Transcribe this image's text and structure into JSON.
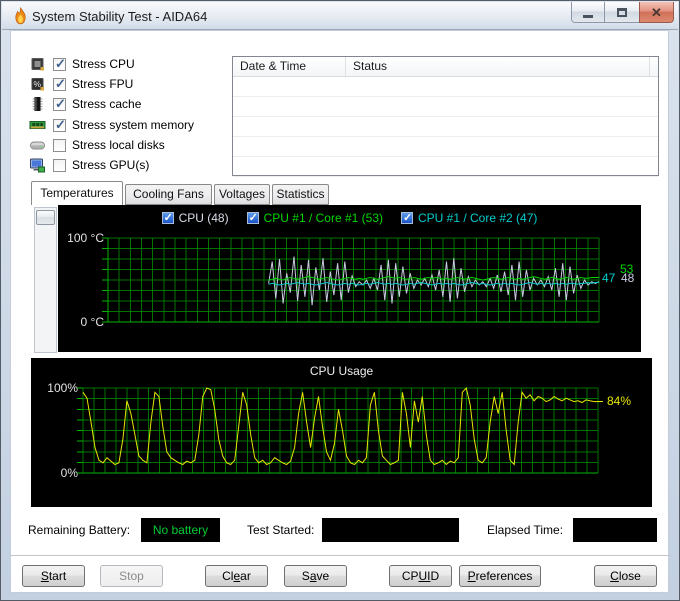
{
  "window": {
    "title": "System Stability Test - AIDA64",
    "icon": "flame-icon",
    "controls": [
      "minimize",
      "maximize",
      "close"
    ]
  },
  "stress": {
    "items": [
      {
        "id": "cpu",
        "label": "Stress CPU",
        "checked": true,
        "icon": "cpu-icon"
      },
      {
        "id": "fpu",
        "label": "Stress FPU",
        "checked": true,
        "icon": "fpu-icon"
      },
      {
        "id": "cache",
        "label": "Stress cache",
        "checked": true,
        "icon": "cache-icon"
      },
      {
        "id": "memory",
        "label": "Stress system memory",
        "checked": true,
        "icon": "memory-icon"
      },
      {
        "id": "disks",
        "label": "Stress local disks",
        "checked": false,
        "icon": "disk-icon"
      },
      {
        "id": "gpu",
        "label": "Stress GPU(s)",
        "checked": false,
        "icon": "gpu-icon"
      }
    ]
  },
  "log_table": {
    "columns": [
      "Date & Time",
      "Status"
    ],
    "empty_rows": 5
  },
  "tabs": [
    {
      "id": "temperatures",
      "label": "Temperatures",
      "active": true
    },
    {
      "id": "cooling-fans",
      "label": "Cooling Fans",
      "active": false
    },
    {
      "id": "voltages",
      "label": "Voltages",
      "active": false
    },
    {
      "id": "statistics",
      "label": "Statistics",
      "active": false
    }
  ],
  "chart_data": [
    {
      "id": "temperatures",
      "type": "line",
      "ylim": [
        0,
        100
      ],
      "grid": true,
      "grid_color": "#007300",
      "axis_color": "#00b300",
      "bg_color": "#000000",
      "y_axis_labels": {
        "top": "100 °C",
        "bottom": "0 °C"
      },
      "legend": [
        {
          "id": "cpu",
          "label": "CPU (48)",
          "color": "#d8dce8",
          "checked": true
        },
        {
          "id": "core1",
          "label": "CPU #1 / Core #1 (53)",
          "color": "#00d800",
          "checked": true
        },
        {
          "id": "core2",
          "label": "CPU #1 / Core #2 (47)",
          "color": "#00cccc",
          "checked": true
        }
      ],
      "series": [
        {
          "name": "CPU",
          "color": "#c8cce0",
          "end_label": "48",
          "x_start_frac": 0.327,
          "values": [
            46,
            72,
            28,
            75,
            22,
            58,
            35,
            78,
            25,
            68,
            30,
            74,
            20,
            65,
            38,
            76,
            24,
            60,
            32,
            70,
            26,
            72,
            35,
            55,
            42,
            48,
            44,
            50,
            40,
            52,
            38,
            68,
            26,
            74,
            22,
            70,
            30,
            66,
            34,
            58,
            40,
            50,
            44,
            52,
            42,
            56,
            38,
            62,
            30,
            72,
            24,
            76,
            28,
            64,
            36,
            54,
            42,
            50,
            44,
            48,
            42,
            52,
            40,
            56,
            36,
            60,
            32,
            68,
            26,
            72,
            30,
            62,
            38,
            52,
            44,
            50,
            42,
            54,
            38,
            64,
            30,
            70,
            26,
            66,
            34,
            56,
            40,
            50,
            44,
            48,
            46,
            48
          ]
        },
        {
          "name": "CPU #1 / Core #1",
          "color": "#00d800",
          "end_label": "53",
          "x_start_frac": 0.327,
          "values": [
            50,
            51,
            52,
            51,
            50,
            52,
            53,
            52,
            51,
            52,
            53,
            54,
            53,
            52,
            51,
            52,
            53,
            52,
            51,
            50,
            51,
            52,
            53,
            52,
            51,
            52,
            51,
            52,
            53,
            52,
            51,
            52,
            53,
            54,
            53,
            52,
            53,
            52,
            51,
            52,
            53,
            52,
            51,
            52,
            53,
            52,
            53,
            52,
            51,
            52,
            51,
            52,
            53,
            52,
            51,
            52,
            53,
            52,
            51,
            50,
            51,
            52,
            53,
            52,
            51,
            52,
            53,
            52,
            51,
            52,
            51,
            52,
            53,
            54,
            53,
            52,
            51,
            52,
            53,
            52,
            51,
            52,
            53,
            52,
            51,
            52,
            53,
            52,
            52,
            53,
            53,
            53
          ]
        },
        {
          "name": "CPU #1 / Core #2",
          "color": "#00cccc",
          "end_label": "47",
          "x_start_frac": 0.327,
          "values": [
            45,
            46,
            45,
            44,
            45,
            46,
            45,
            46,
            47,
            46,
            45,
            46,
            45,
            44,
            45,
            46,
            47,
            46,
            45,
            44,
            45,
            46,
            45,
            46,
            45,
            44,
            45,
            46,
            45,
            46,
            47,
            46,
            45,
            46,
            45,
            46,
            45,
            44,
            45,
            46,
            45,
            46,
            47,
            46,
            45,
            44,
            45,
            46,
            45,
            46,
            45,
            46,
            45,
            44,
            45,
            46,
            47,
            46,
            45,
            46,
            45,
            44,
            45,
            46,
            45,
            46,
            45,
            46,
            45,
            44,
            45,
            46,
            47,
            46,
            45,
            46,
            45,
            46,
            45,
            46,
            45,
            46,
            45,
            46,
            46,
            45,
            46,
            46,
            47,
            46,
            47,
            47
          ]
        }
      ]
    },
    {
      "id": "cpu_usage",
      "type": "line",
      "title": "CPU Usage",
      "ylim": [
        0,
        100
      ],
      "grid": true,
      "grid_color": "#007300",
      "axis_color": "#00b300",
      "bg_color": "#000000",
      "y_axis_labels": {
        "top": "100%",
        "bottom": "0%"
      },
      "series": [
        {
          "name": "CPU Usage",
          "color": "#e6e600",
          "end_label": "84%",
          "x_start_frac": 0,
          "values": [
            95,
            88,
            60,
            30,
            15,
            12,
            18,
            14,
            10,
            12,
            40,
            85,
            70,
            45,
            20,
            15,
            12,
            60,
            95,
            90,
            55,
            25,
            18,
            15,
            12,
            10,
            14,
            12,
            15,
            45,
            90,
            100,
            98,
            75,
            40,
            20,
            12,
            10,
            15,
            55,
            95,
            80,
            45,
            18,
            12,
            15,
            10,
            12,
            18,
            15,
            12,
            10,
            14,
            30,
            70,
            95,
            60,
            30,
            65,
            90,
            55,
            25,
            15,
            35,
            75,
            50,
            20,
            12,
            10,
            15,
            12,
            18,
            80,
            95,
            50,
            20,
            15,
            10,
            12,
            15,
            95,
            70,
            30,
            85,
            60,
            90,
            45,
            15,
            10,
            12,
            15,
            10,
            14,
            12,
            18,
            95,
            100,
            80,
            40,
            15,
            12,
            18,
            60,
            90,
            70,
            95,
            50,
            15,
            10,
            60,
            95,
            88,
            92,
            85,
            90,
            88,
            84,
            86,
            90,
            87,
            85,
            88,
            86,
            84,
            85,
            83,
            86,
            85,
            84,
            84
          ]
        }
      ]
    }
  ],
  "status_bar": {
    "battery_label": "Remaining Battery:",
    "battery_value": "No battery",
    "battery_color": "#00cc33",
    "test_started_label": "Test Started:",
    "test_started_value": "",
    "elapsed_label": "Elapsed Time:",
    "elapsed_value": ""
  },
  "buttons": [
    {
      "id": "start",
      "pre": "",
      "key": "S",
      "post": "tart",
      "disabled": false
    },
    {
      "id": "stop",
      "pre": "Stop",
      "key": "",
      "post": "",
      "disabled": true
    },
    {
      "id": "clear",
      "pre": "Cl",
      "key": "e",
      "post": "ar",
      "disabled": false
    },
    {
      "id": "save",
      "pre": "S",
      "key": "a",
      "post": "ve",
      "disabled": false
    },
    {
      "id": "cpuid",
      "pre": "CP",
      "key": "UI",
      "post": "D",
      "disabled": false
    },
    {
      "id": "preferences",
      "pre": "",
      "key": "P",
      "post": "references",
      "disabled": false
    },
    {
      "id": "close",
      "pre": "",
      "key": "C",
      "post": "lose",
      "disabled": false
    }
  ]
}
